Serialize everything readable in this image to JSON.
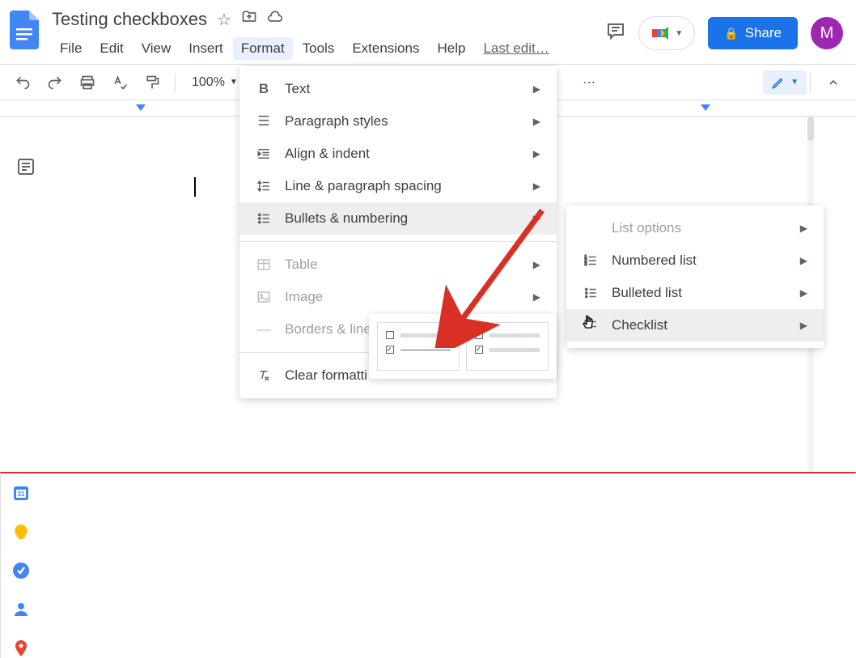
{
  "header": {
    "doc_title": "Testing checkboxes",
    "last_edit": "Last edit…",
    "share_label": "Share",
    "avatar_initial": "M"
  },
  "menubar": {
    "items": [
      "File",
      "Edit",
      "View",
      "Insert",
      "Format",
      "Tools",
      "Extensions",
      "Help"
    ]
  },
  "toolbar": {
    "zoom": "100%"
  },
  "format_menu": {
    "items": [
      {
        "label": "Text",
        "has_submenu": true,
        "icon": "bold"
      },
      {
        "label": "Paragraph styles",
        "has_submenu": true,
        "icon": "lines"
      },
      {
        "label": "Align & indent",
        "has_submenu": true,
        "icon": "indent"
      },
      {
        "label": "Line & paragraph spacing",
        "has_submenu": true,
        "icon": "spacing"
      },
      {
        "label": "Bullets & numbering",
        "has_submenu": true,
        "icon": "bullets",
        "highlighted": true
      },
      {
        "separator": true
      },
      {
        "label": "Table",
        "has_submenu": true,
        "icon": "table",
        "disabled": true
      },
      {
        "label": "Image",
        "has_submenu": true,
        "icon": "image",
        "disabled": true
      },
      {
        "label": "Borders & lines",
        "has_submenu": true,
        "icon": "line",
        "disabled": true,
        "truncated": "Borders & line"
      },
      {
        "separator": true
      },
      {
        "label": "Clear formatting",
        "icon": "clear",
        "truncated": "Clear formatti"
      }
    ]
  },
  "submenu": {
    "items": [
      {
        "label": "List options",
        "has_submenu": true,
        "disabled": true
      },
      {
        "label": "Numbered list",
        "has_submenu": true,
        "icon": "numbered"
      },
      {
        "label": "Bulleted list",
        "has_submenu": true,
        "icon": "bulleted"
      },
      {
        "label": "Checklist",
        "has_submenu": true,
        "icon": "checklist",
        "highlighted": true
      }
    ]
  }
}
